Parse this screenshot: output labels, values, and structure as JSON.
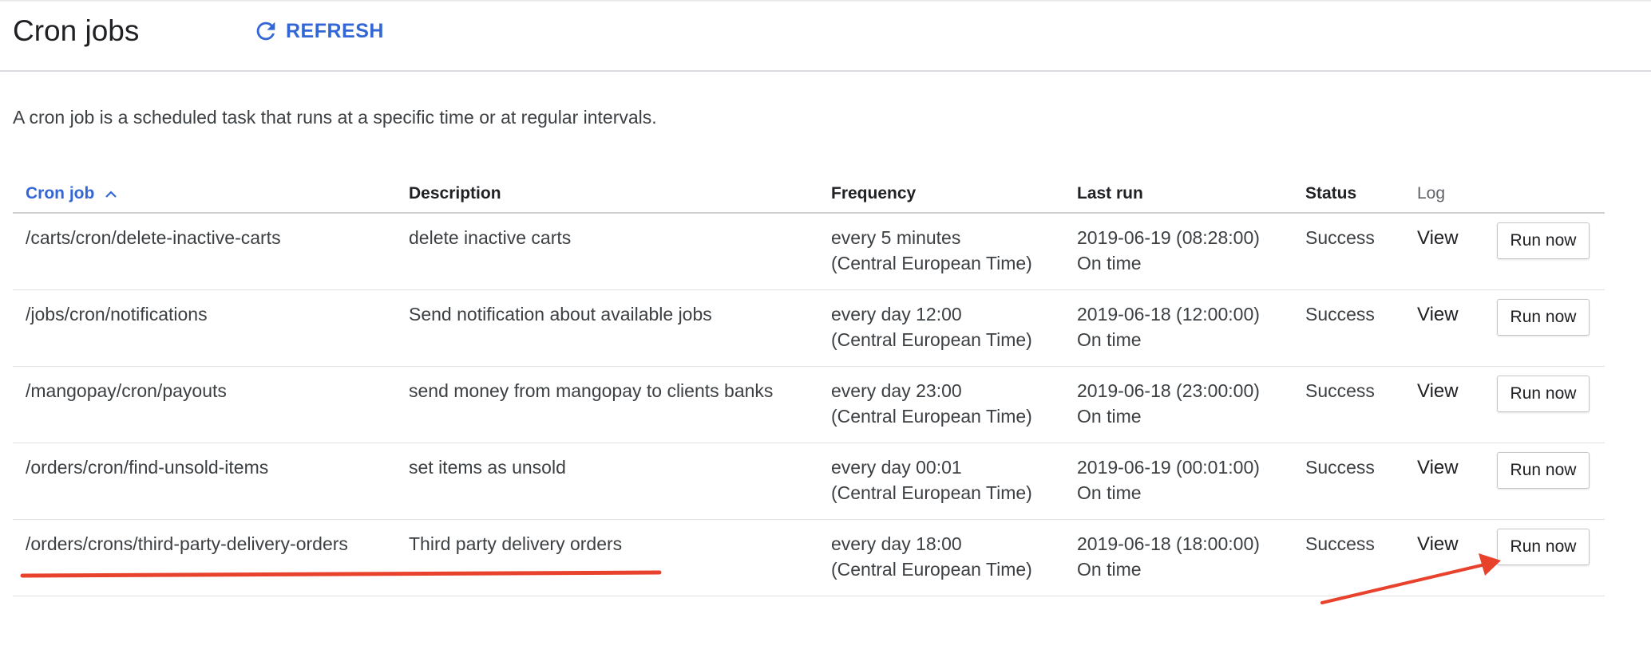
{
  "header": {
    "title": "Cron jobs",
    "refresh_label": "REFRESH"
  },
  "intro": "A cron job is a scheduled task that runs at a specific time or at regular intervals.",
  "table": {
    "columns": [
      "Cron job",
      "Description",
      "Frequency",
      "Last run",
      "Status",
      "Log"
    ],
    "rows": [
      {
        "job": "/carts/cron/delete-inactive-carts",
        "description": "delete inactive carts",
        "frequency": "every 5 minutes",
        "timezone": "(Central European Time)",
        "last_run": "2019-06-19 (08:28:00)",
        "timing": "On time",
        "status": "Success",
        "log": "View",
        "action": "Run now"
      },
      {
        "job": "/jobs/cron/notifications",
        "description": "Send notification about available jobs",
        "frequency": "every day 12:00",
        "timezone": "(Central European Time)",
        "last_run": "2019-06-18 (12:00:00)",
        "timing": "On time",
        "status": "Success",
        "log": "View",
        "action": "Run now"
      },
      {
        "job": "/mangopay/cron/payouts",
        "description": "send money from mangopay to clients banks",
        "frequency": "every day 23:00",
        "timezone": "(Central European Time)",
        "last_run": "2019-06-18 (23:00:00)",
        "timing": "On time",
        "status": "Success",
        "log": "View",
        "action": "Run now"
      },
      {
        "job": "/orders/cron/find-unsold-items",
        "description": "set items as unsold",
        "frequency": "every day 00:01",
        "timezone": "(Central European Time)",
        "last_run": "2019-06-19 (00:01:00)",
        "timing": "On time",
        "status": "Success",
        "log": "View",
        "action": "Run now"
      },
      {
        "job": "/orders/crons/third-party-delivery-orders",
        "description": "Third party delivery orders",
        "frequency": "every day 18:00",
        "timezone": "(Central European Time)",
        "last_run": "2019-06-18 (18:00:00)",
        "timing": "On time",
        "status": "Success",
        "log": "View",
        "action": "Run now"
      }
    ]
  },
  "colors": {
    "accent": "#3367d6",
    "annotation": "#e8412c",
    "divider": "#dadce0"
  },
  "icons": {
    "refresh": "refresh-icon",
    "sort": "chevron-up-icon"
  }
}
